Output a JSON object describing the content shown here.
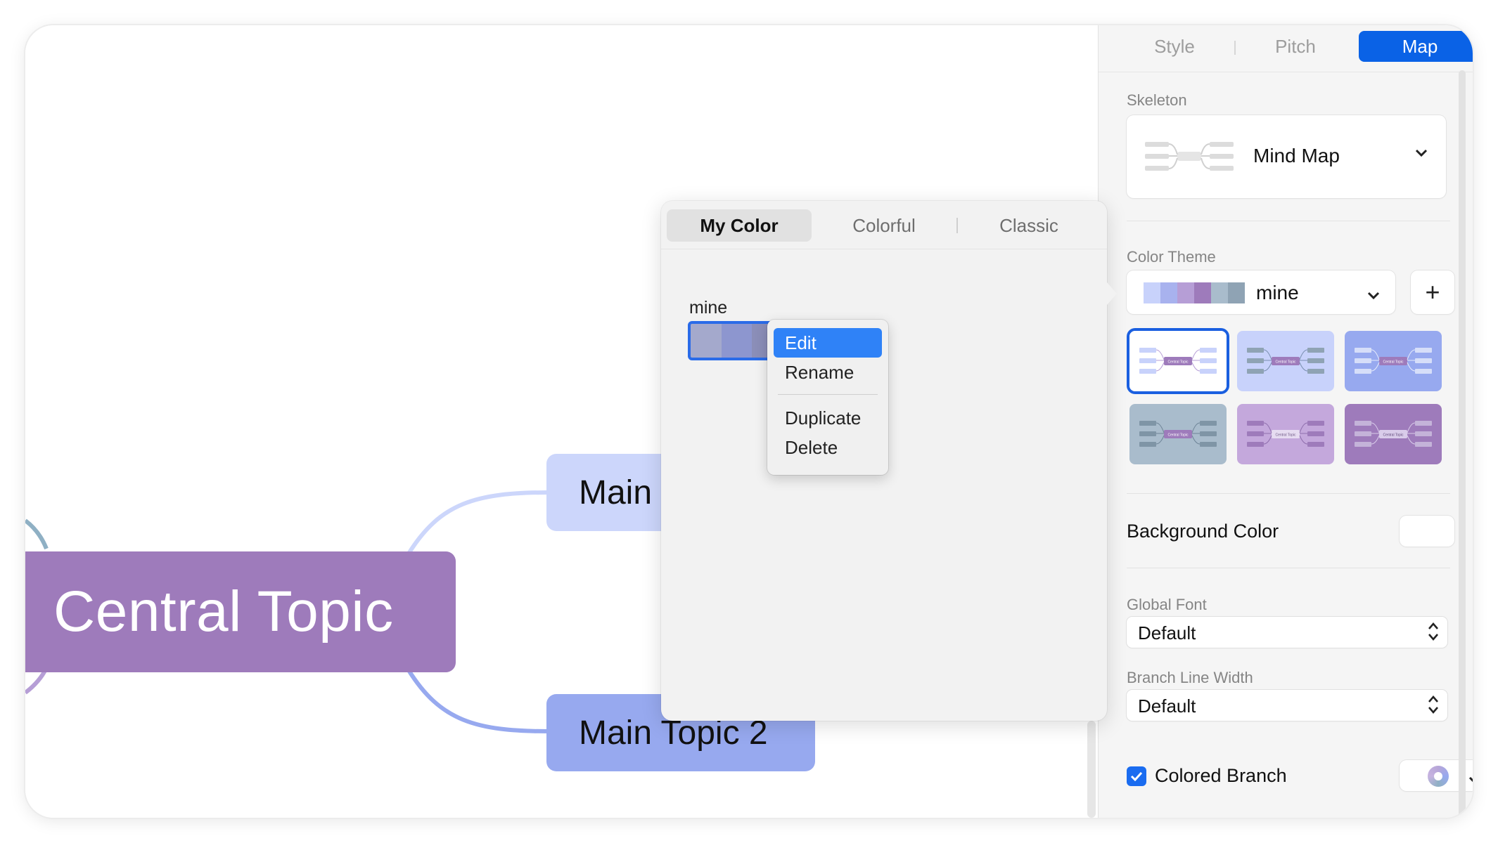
{
  "canvas": {
    "central_topic": "Central Topic",
    "main_topic_1": "Main",
    "main_topic_2": "Main Topic 2"
  },
  "popover": {
    "tabs": [
      "My Color",
      "Colorful",
      "Classic"
    ],
    "active_tab": "My Color",
    "theme_name": "mine",
    "swatch_colors": [
      "#a4a9cc",
      "#8d96cf",
      "#8b8eb8",
      "#7d7fa8",
      "#9a83b6",
      "#8c7aa6"
    ],
    "context_menu": [
      "Edit",
      "Rename",
      "Duplicate",
      "Delete"
    ],
    "context_menu_active": "Edit"
  },
  "sidebar": {
    "tabs": [
      "Style",
      "Pitch",
      "Map"
    ],
    "active_tab": "Map",
    "skeleton_label": "Skeleton",
    "skeleton_value": "Mind Map",
    "color_theme_label": "Color Theme",
    "color_theme_value": "mine",
    "color_theme_strip": [
      "#c8d2fb",
      "#a8b2ee",
      "#b69ed6",
      "#9e7bbb",
      "#a9bccc",
      "#8fa3b4"
    ],
    "plus_label": "+",
    "background_color_label": "Background Color",
    "global_font_label": "Global Font",
    "global_font_value": "Default",
    "branch_line_width_label": "Branch Line Width",
    "branch_line_width_value": "Default",
    "colored_branch_label": "Colored Branch",
    "colored_branch_checked": true
  },
  "theme_thumbnail_labels": {
    "central": "Central Topic",
    "main": "Main Topic"
  },
  "icons": {
    "chevron": "chevron-down-icon",
    "updown": "updown-chevron-icon",
    "check": "checkmark-icon"
  },
  "colors": {
    "accent": "#0a62e6",
    "central_topic": "#9e7bbb",
    "main_topic_1": "#ccd6fb",
    "main_topic_2": "#97a9ef",
    "menu_highlight": "#2f82f7"
  }
}
